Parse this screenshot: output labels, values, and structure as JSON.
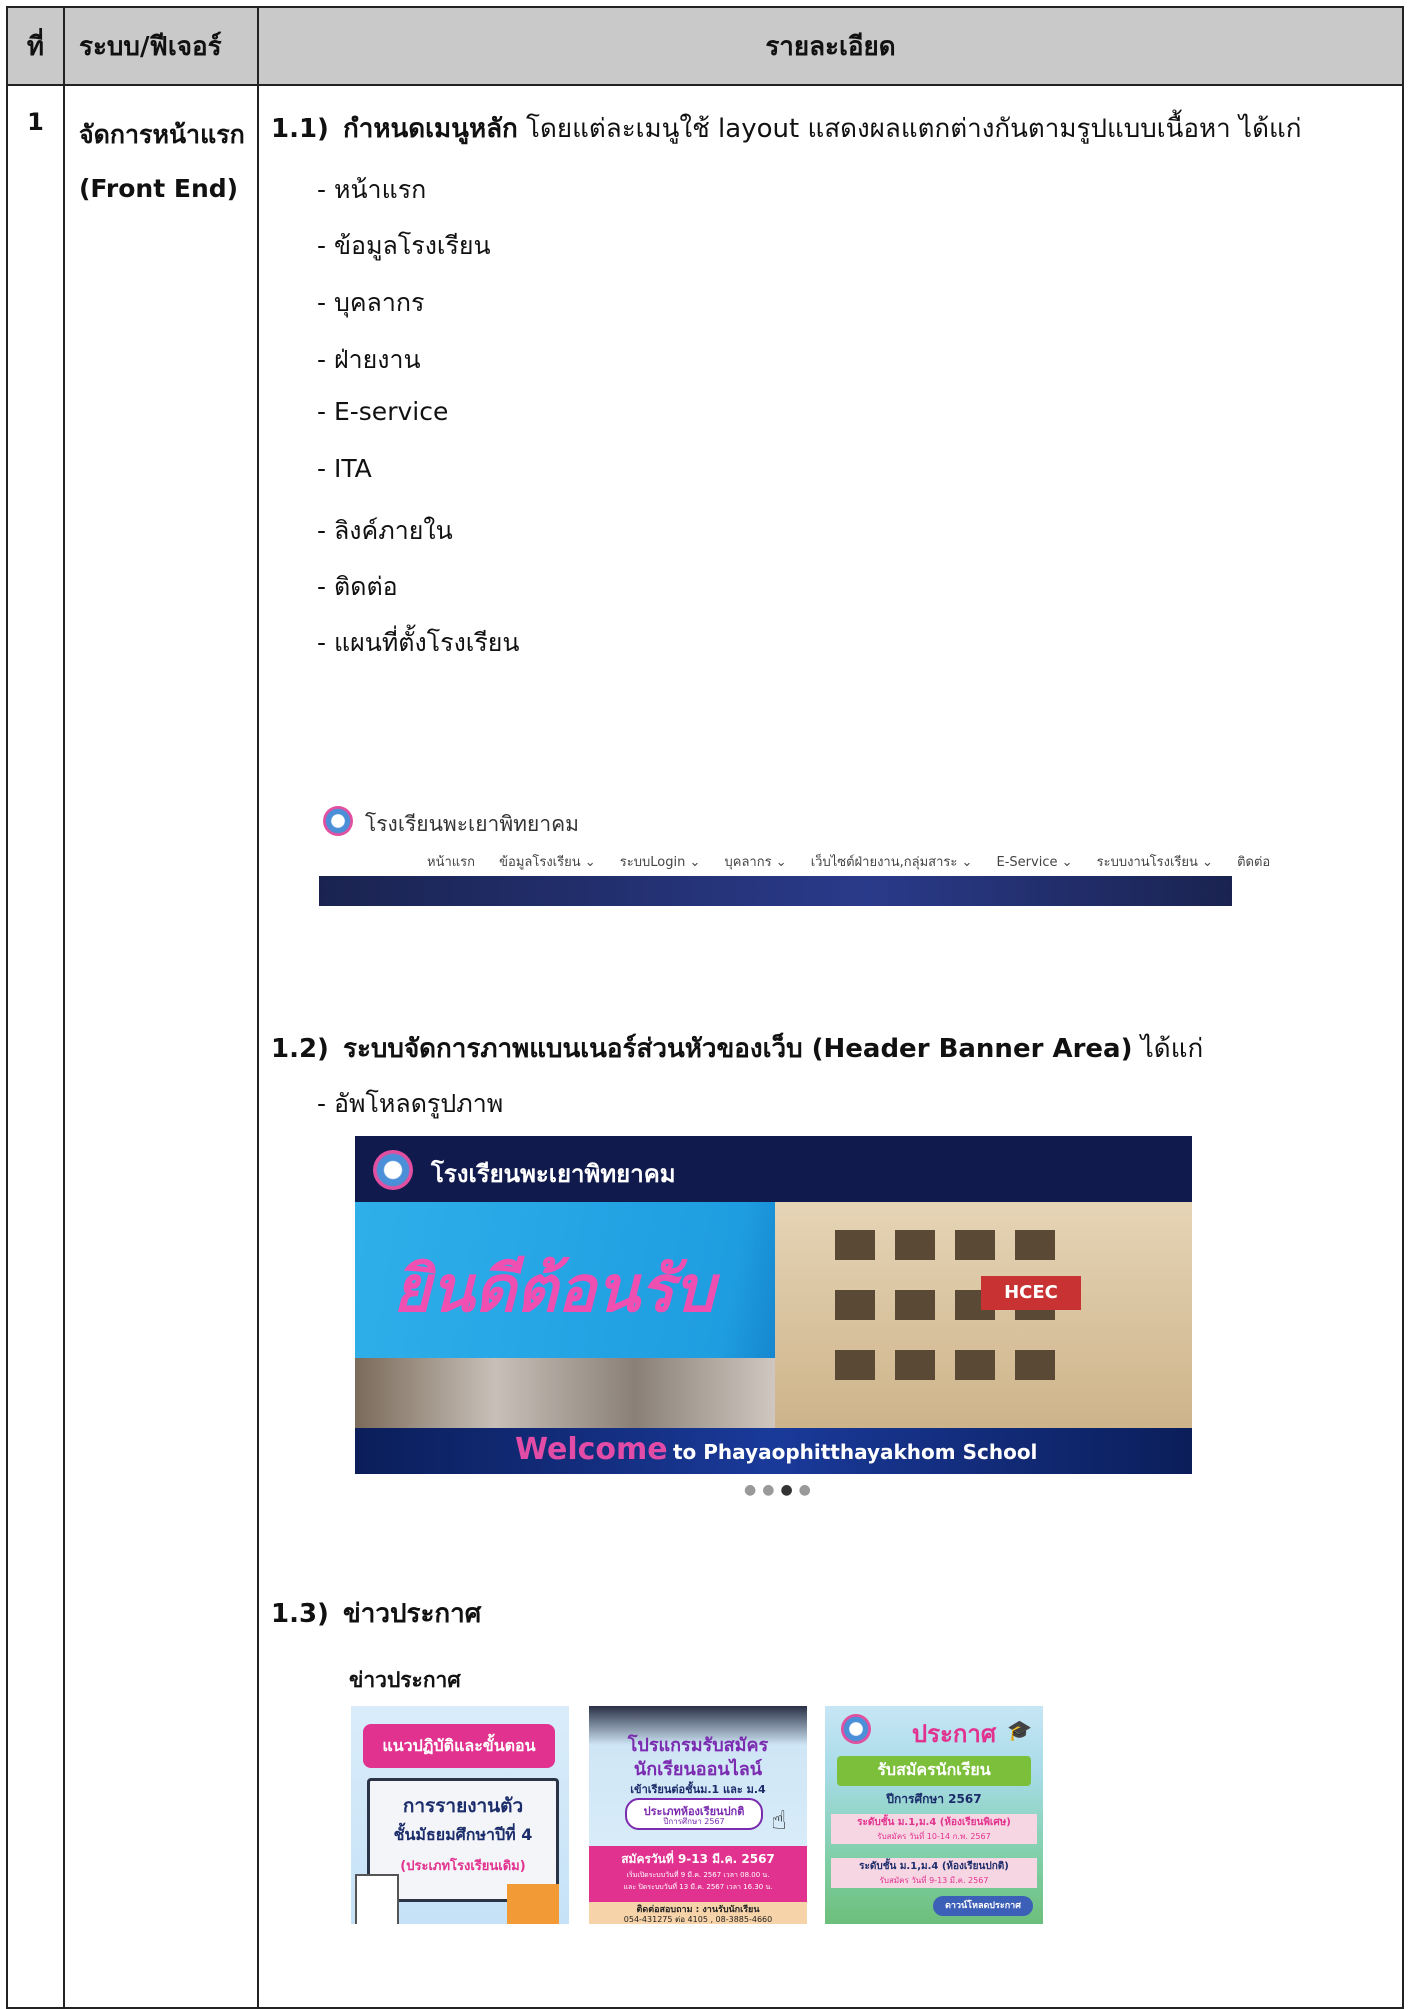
{
  "table": {
    "headers": [
      "ที่",
      "ระบบ/ฟีเจอร์",
      "รายละเอียด"
    ],
    "row": {
      "no": "1",
      "system_line1": "จัดการหน้าแรก",
      "system_line2": "(Front End)"
    }
  },
  "section1": {
    "num": "1.1)",
    "title_bold": "กำหนดเมนูหลัก",
    "title_rest": " โดยแต่ละเมนูใช้ layout แสดงผลแตกต่างกันตามรูปแบบเนื้อหา ได้แก่",
    "items": [
      "หน้าแรก",
      "ข้อมูลโรงเรียน",
      "บุคลากร",
      "ฝ่ายงาน",
      "E-service",
      "ITA",
      "ลิงค์ภายใน",
      "ติดต่อ",
      "แผนที่ตั้งโรงเรียน"
    ]
  },
  "nav_preview": {
    "school_name": "โรงเรียนพะเยาพิทยาคม",
    "menu": [
      "หน้าแรก",
      "ข้อมูลโรงเรียน ⌄",
      "ระบบLogin ⌄",
      "บุคลากร ⌄",
      "เว็บไซต์ฝ่ายงาน,กลุ่มสาระ ⌄",
      "E-Service ⌄",
      "ระบบงานโรงเรียน ⌄",
      "ติดต่อ"
    ]
  },
  "section2": {
    "num": "1.2)",
    "title_bold": "ระบบจัดการภาพแบนเนอร์ส่วนหัวของเว็บ (Header Banner Area)",
    "title_rest": " ได้แก่",
    "items": [
      "อัพโหลดรูปภาพ"
    ]
  },
  "banner": {
    "school_name": "โรงเรียนพะเยาพิทยาคม",
    "welcome_th": "ยินดีต้อนรับ",
    "welcome_en": "Welcome",
    "welcome_sub": "to Phayaophitthayakhom School",
    "building_sign": "HCEC"
  },
  "section3": {
    "num": "1.3)",
    "title_bold": "ข่าวประกาศ"
  },
  "news": {
    "heading": "ข่าวประกาศ",
    "card1": {
      "pill": "แนวปฏิบัติและขั้นตอน",
      "line1": "การรายงานตัว",
      "line2": "ชั้นมัธยมศึกษาปีที่ 4",
      "line3": "(ประเภทโรงเรียนเดิม)"
    },
    "card2": {
      "line1": "โปรแกรมรับสมัคร",
      "line2": "นักเรียนออนไลน์",
      "line3": "เข้าเรียนต่อชั้นม.1 และ ม.4",
      "line4": "ประเภทห้องเรียนปกติ",
      "line5": "ปีการศึกษา 2567",
      "line6": "สมัครวันที่ 9-13 มี.ค. 2567",
      "line7": "เริ่มเปิดระบบวันที่ 9 มี.ค. 2567 เวลา 08.00 น.",
      "line8": "และ ปิดระบบวันที่ 13 มี.ค. 2567 เวลา 16.30 น.",
      "line9": "ติดต่อสอบถาม : งานรับนักเรียน",
      "line10": "054-431275 ต่อ 4105 , 08-3885-4660"
    },
    "card3": {
      "title": "ประกาศ",
      "line1": "รับสมัครนักเรียน",
      "line2": "ปีการศึกษา 2567",
      "line3": "ระดับชั้น ม.1,ม.4 (ห้องเรียนพิเศษ)",
      "line4": "รับสมัคร วันที่ 10-14 ก.พ. 2567",
      "line5": "ระดับชั้น ม.1,ม.4 (ห้องเรียนปกติ)",
      "line6": "รับสมัคร วันที่ 9-13 มี.ค. 2567",
      "button": "ดาวน์โหลดประกาศ"
    }
  }
}
